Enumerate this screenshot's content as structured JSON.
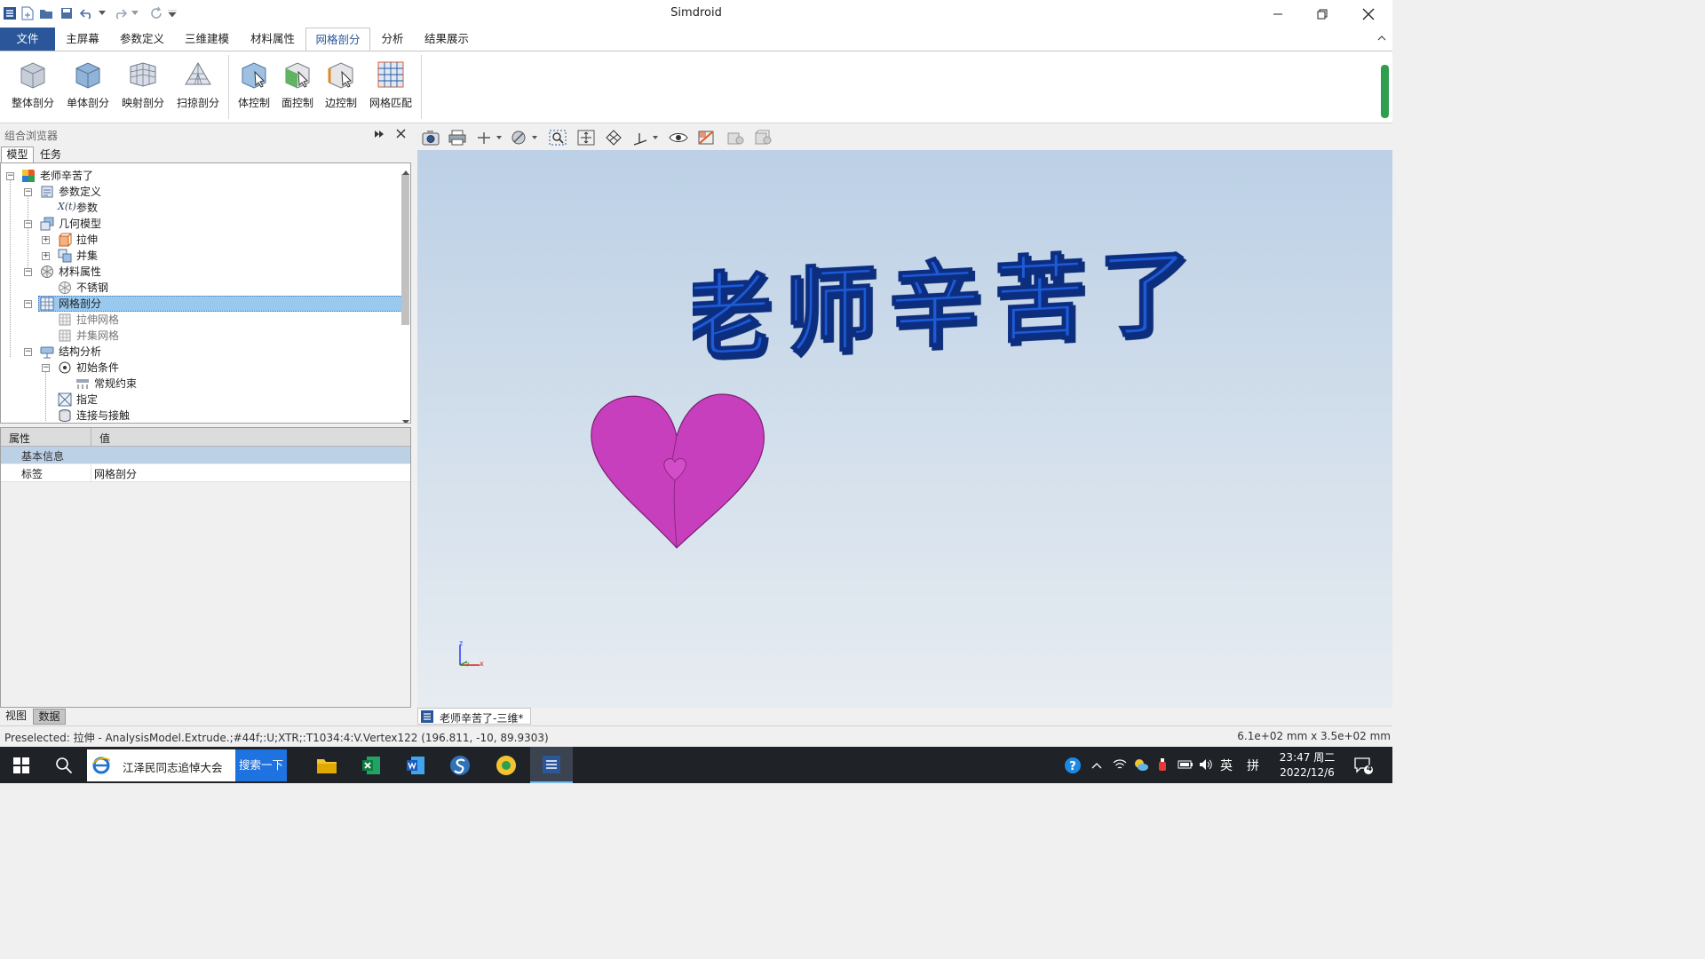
{
  "window": {
    "title": "Simdroid"
  },
  "ribbon_tabs": {
    "file": "文件",
    "home": "主屏幕",
    "params": "参数定义",
    "modeling": "三维建模",
    "material": "材料属性",
    "mesh": "网格剖分",
    "analysis": "分析",
    "results": "结果展示"
  },
  "ribbon_buttons": {
    "whole": "整体剖分",
    "single": "单体剖分",
    "mapped": "映射剖分",
    "sweep": "扫掠剖分",
    "body_ctrl": "体控制",
    "face_ctrl": "面控制",
    "edge_ctrl": "边控制",
    "mesh_match": "网格匹配"
  },
  "browser": {
    "title": "组合浏览器",
    "tab_model": "模型",
    "tab_task": "任务"
  },
  "tree": {
    "root": "老师辛苦了",
    "param_def": "参数定义",
    "param_icon": "X(t)",
    "param": "参数",
    "geom_model": "几何模型",
    "extrude": "拉伸",
    "union": "并集",
    "material_prop": "材料属性",
    "stainless": "不锈钢",
    "mesh": "网格剖分",
    "extrude_mesh": "拉伸网格",
    "union_mesh": "并集网格",
    "struct_analysis": "结构分析",
    "init_cond": "初始条件",
    "constraint": "常规约束",
    "assign": "指定",
    "contact": "连接与接触"
  },
  "properties": {
    "col_prop": "属性",
    "col_value": "值",
    "group": "基本信息",
    "row_label": "标签",
    "row_value": "网格剖分"
  },
  "bottom_tabs": {
    "view": "视图",
    "data": "数据"
  },
  "viewport": {
    "text3d": "老师辛苦了",
    "doc_tab": "老师辛苦了-三维*",
    "axis_z": "z",
    "axis_x": "x",
    "axis_y": "y"
  },
  "status": {
    "left": "Preselected: 拉伸 - AnalysisModel.Extrude.;#44f;:U;XTR;:T1034:4:V.Vertex122 (196.811, -10, 89.9303)",
    "right": "6.1e+02 mm x 3.5e+02 mm"
  },
  "taskbar": {
    "browser_title": "江泽民同志追悼大会",
    "search_button": "搜索一下",
    "ime_lang": "英",
    "ime_mode": "拼",
    "time": "23:47 周二",
    "date": "2022/12/6",
    "notif_count": "4"
  },
  "colors": {
    "accent": "#2b579a",
    "selection": "#99c9ef",
    "text3d": "#1e5bd8",
    "heart": "#c83fbd"
  }
}
